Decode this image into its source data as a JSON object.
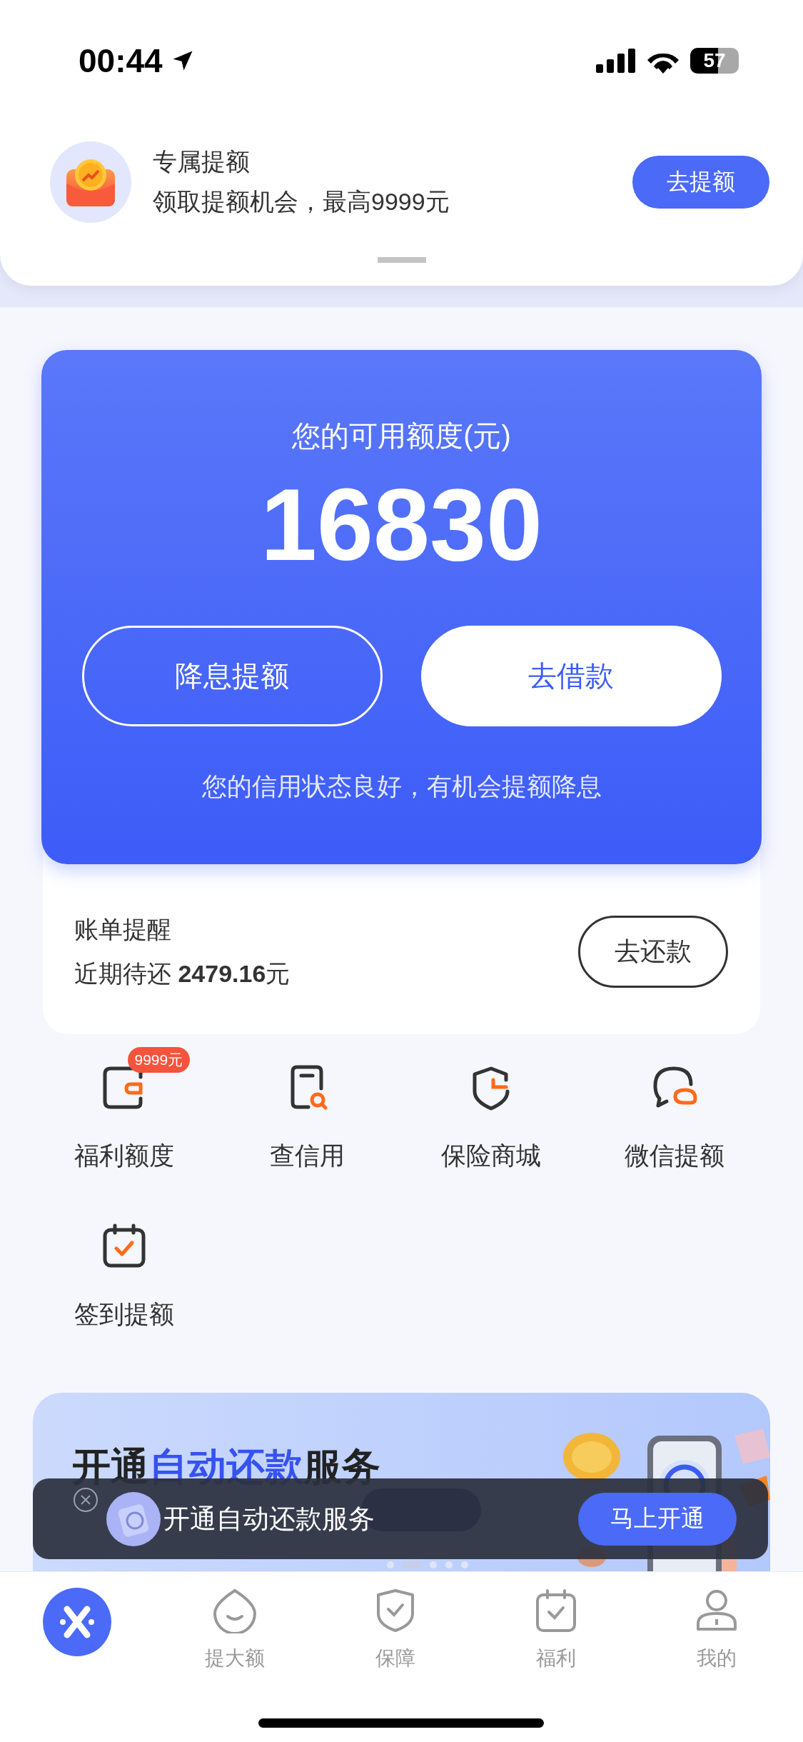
{
  "status_bar": {
    "time": "00:44",
    "battery": "57"
  },
  "notice": {
    "title": "专属提额",
    "subtitle": "领取提额机会，最高9999元",
    "button": "去提额"
  },
  "credit_card": {
    "title": "您的可用额度(元)",
    "amount": "16830",
    "buttons": [
      {
        "label": "降息提额",
        "kind": "outline"
      },
      {
        "label": "去借款",
        "kind": "solid"
      }
    ],
    "note": "您的信用状态良好，有机会提额降息"
  },
  "bill": {
    "title": "账单提醒",
    "detail": "近期待还 **2479.16**元",
    "button": "去还款"
  },
  "services": [
    {
      "kind": "wallet",
      "label": "福利额度",
      "badge": "9999元"
    },
    {
      "kind": "doc-search",
      "label": "查信用"
    },
    {
      "kind": "shield",
      "label": "保险商城"
    },
    {
      "kind": "chat",
      "label": "微信提额"
    },
    {
      "kind": "calendar",
      "label": "签到提额"
    }
  ],
  "banner": {
    "title_start": "开通",
    "title_highlight": "自动还款",
    "title_end": "服务"
  },
  "toast": {
    "text": "开通自动还款服务",
    "button": "马上开通"
  },
  "tabs": [
    {
      "kind": "home",
      "selected": true
    },
    {
      "kind": "drop",
      "label": "提大额",
      "selected": false
    },
    {
      "kind": "shield",
      "label": "保障",
      "selected": false
    },
    {
      "kind": "calendar",
      "label": "福利",
      "selected": false
    },
    {
      "kind": "person",
      "label": "我的",
      "selected": false
    }
  ]
}
